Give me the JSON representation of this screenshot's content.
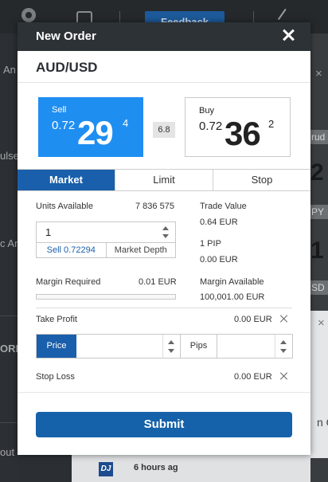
{
  "background": {
    "feedback_label": "Feedback",
    "sidebar_texts": [
      "An",
      "ulse",
      "c An",
      "ORM",
      "out"
    ],
    "right_bands": [
      "rud",
      "PY",
      "SD"
    ],
    "right_numbers": [
      "2",
      "1"
    ],
    "right_partial": "n O",
    "bottom_badge": "DJ",
    "bottom_time": "6 hours ag"
  },
  "modal": {
    "title": "New Order",
    "pair": "AUD/USD",
    "sell": {
      "label": "Sell",
      "prefix": "0.72",
      "big": "29",
      "sup": "4"
    },
    "buy": {
      "label": "Buy",
      "prefix": "0.72",
      "big": "36",
      "sup": "2"
    },
    "spread": "6.8",
    "tabs": [
      {
        "label": "Market",
        "active": true
      },
      {
        "label": "Limit",
        "active": false
      },
      {
        "label": "Stop",
        "active": false
      }
    ],
    "units_available_label": "Units Available",
    "units_available_value": "7 836 575",
    "units_value": "1",
    "units_sell_link": "Sell 0.72294",
    "market_depth_link": "Market Depth",
    "trade_value_label": "Trade Value",
    "trade_value": "0.64 EUR",
    "pip_label": "1 PIP",
    "pip_value": "0.00 EUR",
    "margin_required_label": "Margin Required",
    "margin_required_value": "0.01 EUR",
    "margin_available_label": "Margin Available",
    "margin_available_value": "100,001.00 EUR",
    "take_profit_label": "Take Profit",
    "take_profit_value": "0.00 EUR",
    "price_button": "Price",
    "pips_button": "Pips",
    "stop_loss_label": "Stop Loss",
    "stop_loss_value": "0.00 EUR",
    "submit_label": "Submit"
  },
  "colors": {
    "header": "#2d3236",
    "sell": "#1f8ef1",
    "accent": "#1a5fab",
    "submit": "#1561aa"
  }
}
